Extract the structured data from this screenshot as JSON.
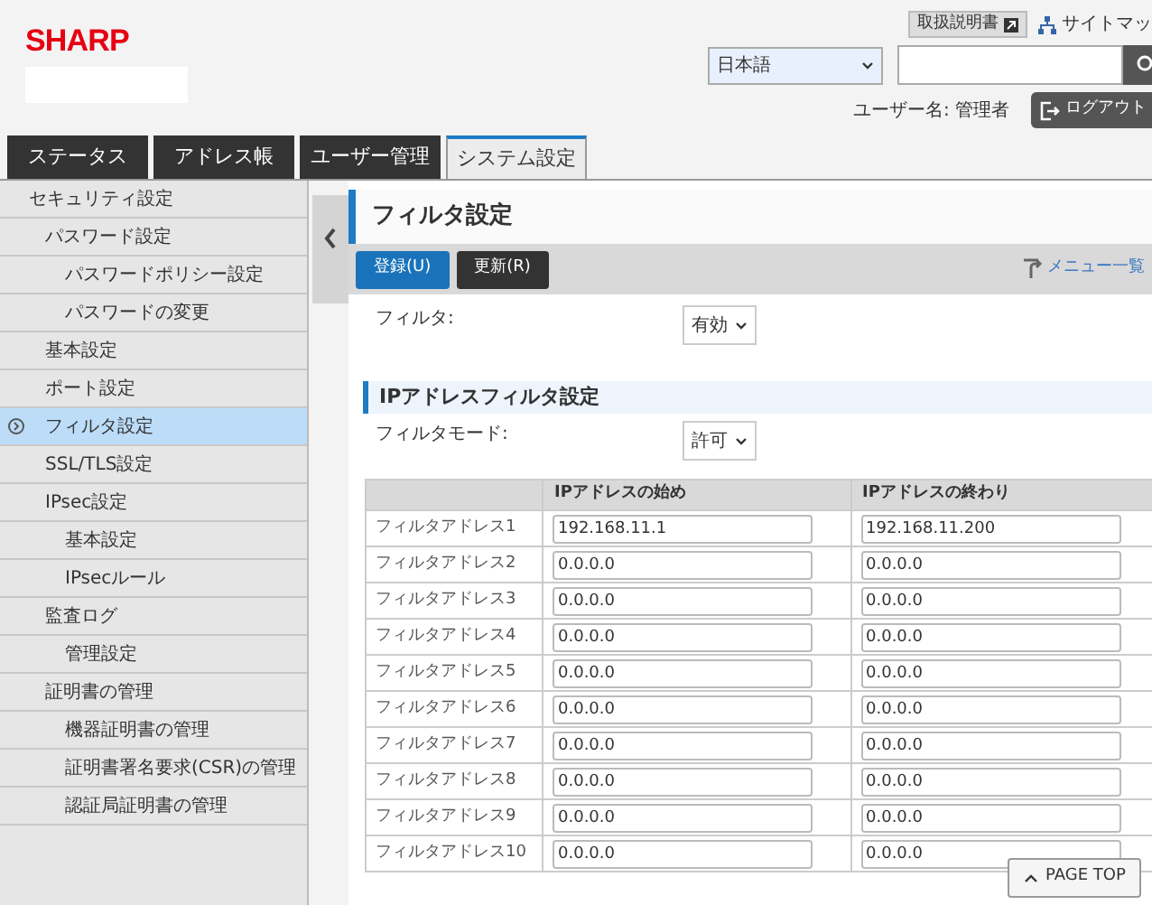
{
  "header": {
    "logo": "SHARP",
    "manual_button": "取扱説明書",
    "sitemap_link": "サイトマッ",
    "language": "日本語",
    "user_label": "ユーザー名: 管理者",
    "logout_button": "ログアウト"
  },
  "tabs": [
    {
      "label": "ステータス",
      "selected": false
    },
    {
      "label": "アドレス帳",
      "selected": false
    },
    {
      "label": "ユーザー管理",
      "selected": false
    },
    {
      "label": "システム設定",
      "selected": true
    }
  ],
  "sidebar": {
    "items": [
      {
        "label": "セキュリティ設定",
        "selected": false,
        "children": [
          {
            "label": "パスワード設定",
            "selected": false,
            "children": [
              {
                "label": "パスワードポリシー設定",
                "selected": false
              },
              {
                "label": "パスワードの変更",
                "selected": false
              }
            ]
          },
          {
            "label": "基本設定",
            "selected": false
          },
          {
            "label": "ポート設定",
            "selected": false
          },
          {
            "label": "フィルタ設定",
            "selected": true
          },
          {
            "label": "SSL/TLS設定",
            "selected": false
          },
          {
            "label": "IPsec設定",
            "selected": false,
            "children": [
              {
                "label": "基本設定",
                "selected": false
              },
              {
                "label": "IPsecルール",
                "selected": false
              }
            ]
          },
          {
            "label": "監査ログ",
            "selected": false,
            "children": [
              {
                "label": "管理設定",
                "selected": false
              }
            ]
          },
          {
            "label": "証明書の管理",
            "selected": false,
            "children": [
              {
                "label": "機器証明書の管理",
                "selected": false
              },
              {
                "label": "証明書署名要求(CSR)の管理",
                "selected": false
              },
              {
                "label": "認証局証明書の管理",
                "selected": false
              }
            ]
          }
        ]
      }
    ]
  },
  "page": {
    "title": "フィルタ設定",
    "buttons": [
      {
        "label": "登録(U)",
        "kind": "primary"
      },
      {
        "label": "更新(R)",
        "kind": "secondary"
      }
    ],
    "menu_link": "メニュー一覧",
    "filter": {
      "label": "フィルタ:",
      "value": "有効"
    },
    "section_title": "IPアドレスフィルタ設定",
    "filter_mode": {
      "label": "フィルタモード:",
      "value": "許可"
    },
    "table": {
      "columns": [
        "IPアドレスの始め",
        "IPアドレスの終わり"
      ],
      "rows": [
        {
          "label": "フィルタアドレス1",
          "start": "192.168.11.1",
          "end": "192.168.11.200"
        },
        {
          "label": "フィルタアドレス2",
          "start": "0.0.0.0",
          "end": "0.0.0.0"
        },
        {
          "label": "フィルタアドレス3",
          "start": "0.0.0.0",
          "end": "0.0.0.0"
        },
        {
          "label": "フィルタアドレス4",
          "start": "0.0.0.0",
          "end": "0.0.0.0"
        },
        {
          "label": "フィルタアドレス5",
          "start": "0.0.0.0",
          "end": "0.0.0.0"
        },
        {
          "label": "フィルタアドレス6",
          "start": "0.0.0.0",
          "end": "0.0.0.0"
        },
        {
          "label": "フィルタアドレス7",
          "start": "0.0.0.0",
          "end": "0.0.0.0"
        },
        {
          "label": "フィルタアドレス8",
          "start": "0.0.0.0",
          "end": "0.0.0.0"
        },
        {
          "label": "フィルタアドレス9",
          "start": "0.0.0.0",
          "end": "0.0.0.0"
        },
        {
          "label": "フィルタアドレス10",
          "start": "0.0.0.0",
          "end": "0.0.0.0"
        }
      ]
    },
    "page_top_button": "PAGE TOP"
  }
}
